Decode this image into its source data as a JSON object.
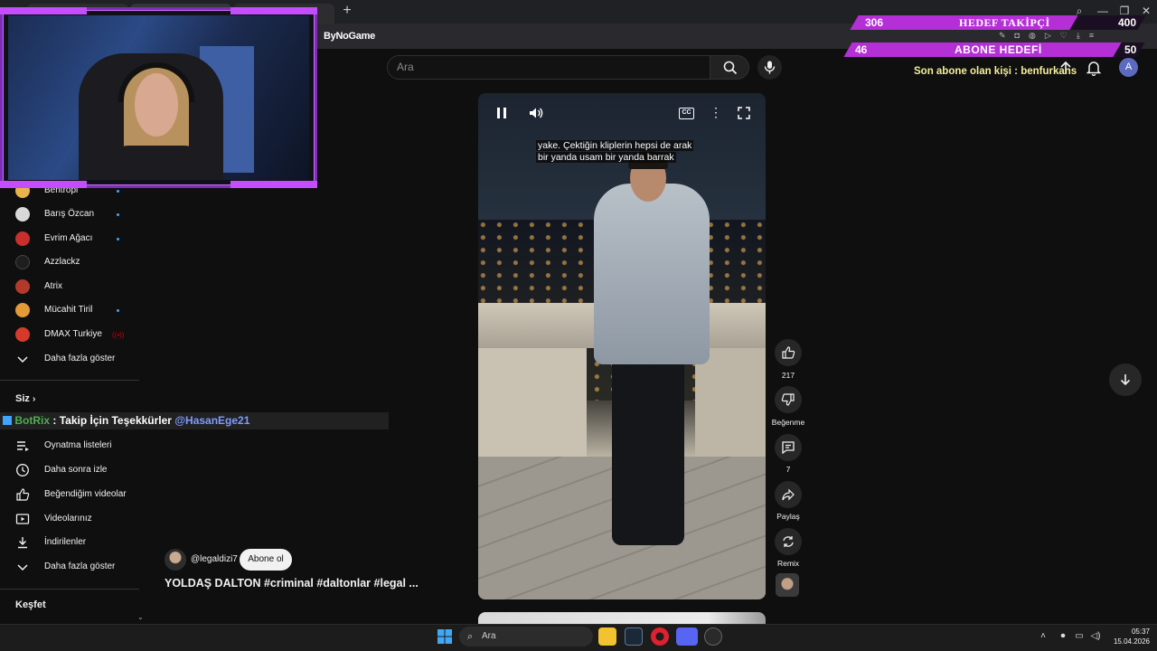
{
  "search": {
    "placeholder": "Ara"
  },
  "site_logo": "ByNoGame",
  "sidebar": {
    "subscriptions": [
      {
        "name": "Bentropi",
        "color": "#e9b54a",
        "new": true
      },
      {
        "name": "Barış Özcan",
        "color": "#d8d8d8",
        "new": true
      },
      {
        "name": "Evrim Ağacı",
        "color": "#c8302c",
        "new": true
      },
      {
        "name": "Azzlackz",
        "color": "#1e1e1e",
        "new": false
      },
      {
        "name": "Atrix",
        "color": "#b33a2a",
        "new": false
      },
      {
        "name": "Mücahit Tiril",
        "color": "#e39b3a",
        "new": true
      },
      {
        "name": "DMAX Turkiye",
        "color": "#d63a2a",
        "live": true
      }
    ],
    "show_more_1": "Daha fazla göster",
    "you_heading": "Siz",
    "you_items": [
      {
        "icon": "playlist-icon",
        "label": "Oynatma listeleri"
      },
      {
        "icon": "watch-later-icon",
        "label": "Daha sonra izle"
      },
      {
        "icon": "liked-videos-icon",
        "label": "Beğendiğim videolar"
      },
      {
        "icon": "your-videos-icon",
        "label": "Videolarınız"
      },
      {
        "icon": "downloads-icon",
        "label": "İndirilenler"
      }
    ],
    "show_more_2": "Daha fazla göster",
    "explore_heading": "Keşfet"
  },
  "chat": {
    "user": "BotRix",
    "separator": ":",
    "message": "Takip İçin Teşekkürler",
    "mention": "@HasanEge21"
  },
  "short": {
    "caption_line1": "yake. Çektiğin kliplerin hepsi de arak",
    "caption_line2": "bir yanda usam bir yanda barrak",
    "cc_label": "CC",
    "channel": "@legaldizi7",
    "subscribe": "Abone ol",
    "title": "YOLDAŞ DALTON #criminal #daltonlar #legal ..."
  },
  "actions": {
    "like_count": "217",
    "dislike_label": "Beğenme",
    "comment_count": "7",
    "share_label": "Paylaş",
    "remix_label": "Remix"
  },
  "stream_overlay": {
    "follower_goal": {
      "label": "HEDEF TAKİPÇİ",
      "current": "306",
      "target": "400",
      "progress": 0.765
    },
    "sub_goal": {
      "label": "ABONE HEDEFİ",
      "current": "46",
      "target": "50",
      "progress": 0.92
    },
    "last_sub": "Son abone olan kişi : benfurkans"
  },
  "header": {
    "avatar_letter": "A"
  },
  "taskbar": {
    "search_placeholder": "Ara",
    "time": "05:37",
    "date": "15.04.2026"
  },
  "colors": {
    "accent_purple": "#b52fd6",
    "link_blue": "#3ea6ff",
    "chat_green": "#4caf50"
  }
}
